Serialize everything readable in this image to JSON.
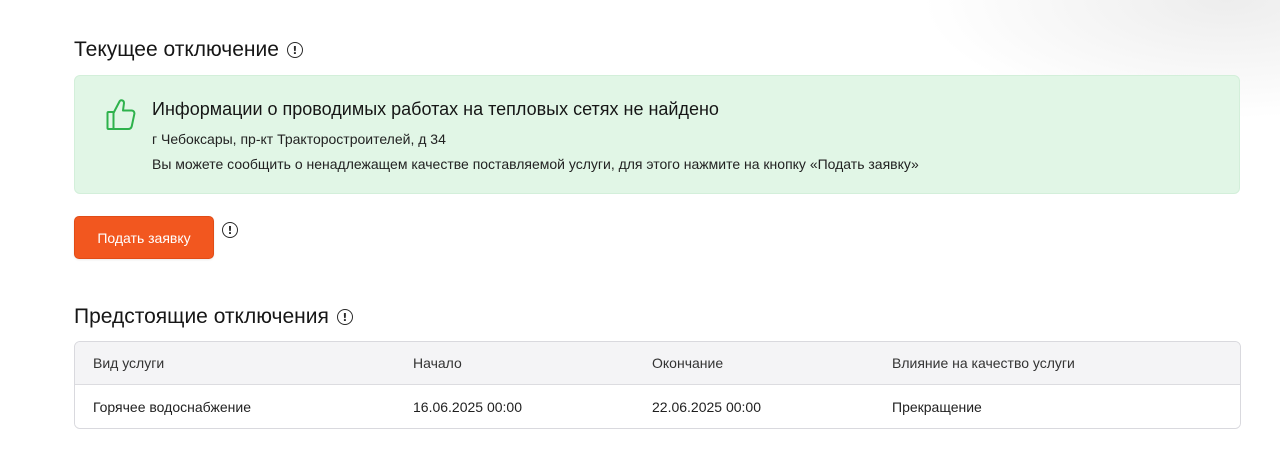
{
  "current": {
    "title": "Текущее отключение",
    "card": {
      "headline": "Информации о проводимых работах на тепловых сетях не найдено",
      "address": "г Чебоксары, пр-кт Тракторостроителей, д 34",
      "hint": "Вы можете сообщить о ненадлежащем качестве поставляемой услуги, для этого нажмите на кнопку «Подать заявку»",
      "icon": "thumbs-up-icon",
      "background": "#e1f6e6",
      "icon_color": "#2eb24c"
    },
    "submit_button": "Подать заявку",
    "button_color": "#f2571f"
  },
  "upcoming": {
    "title": "Предстоящие отключения",
    "columns": [
      "Вид услуги",
      "Начало",
      "Окончание",
      "Влияние на качество услуги"
    ],
    "rows": [
      [
        "Горячее водоснабжение",
        "16.06.2025 00:00",
        "22.06.2025 00:00",
        "Прекращение"
      ]
    ]
  },
  "icons": {
    "info": "!"
  }
}
